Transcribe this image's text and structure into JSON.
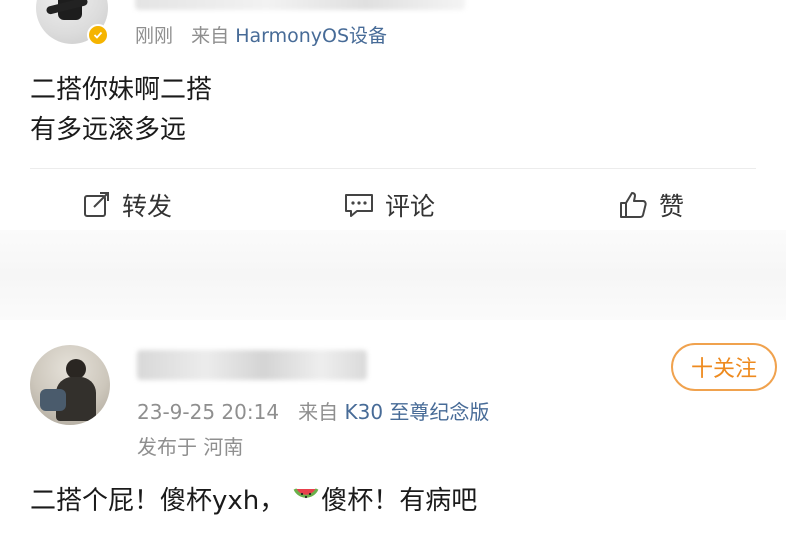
{
  "post": {
    "meta_time": "刚刚",
    "meta_source_prefix": "来自",
    "meta_source": "HarmonyOS设备",
    "content_lines": [
      "二搭你妹啊二搭",
      "有多远滚多远"
    ]
  },
  "actions": {
    "repost": "转发",
    "comment": "评论",
    "like": "赞"
  },
  "comment": {
    "timestamp": "23-9-25 20:14",
    "source_prefix": "来自",
    "source": "K30 至尊纪念版",
    "location": "发布于 河南",
    "follow_label": "十关注",
    "text_before": "二搭个屁！傻杯yxh，",
    "text_after": "傻杯！有病吧",
    "emoji": "watermelon-icon"
  },
  "colors": {
    "link_blue": "#476b97",
    "follow_orange": "#ee8a1e",
    "verified_gold": "#f5b400",
    "meta_gray": "#8f8f8f"
  }
}
